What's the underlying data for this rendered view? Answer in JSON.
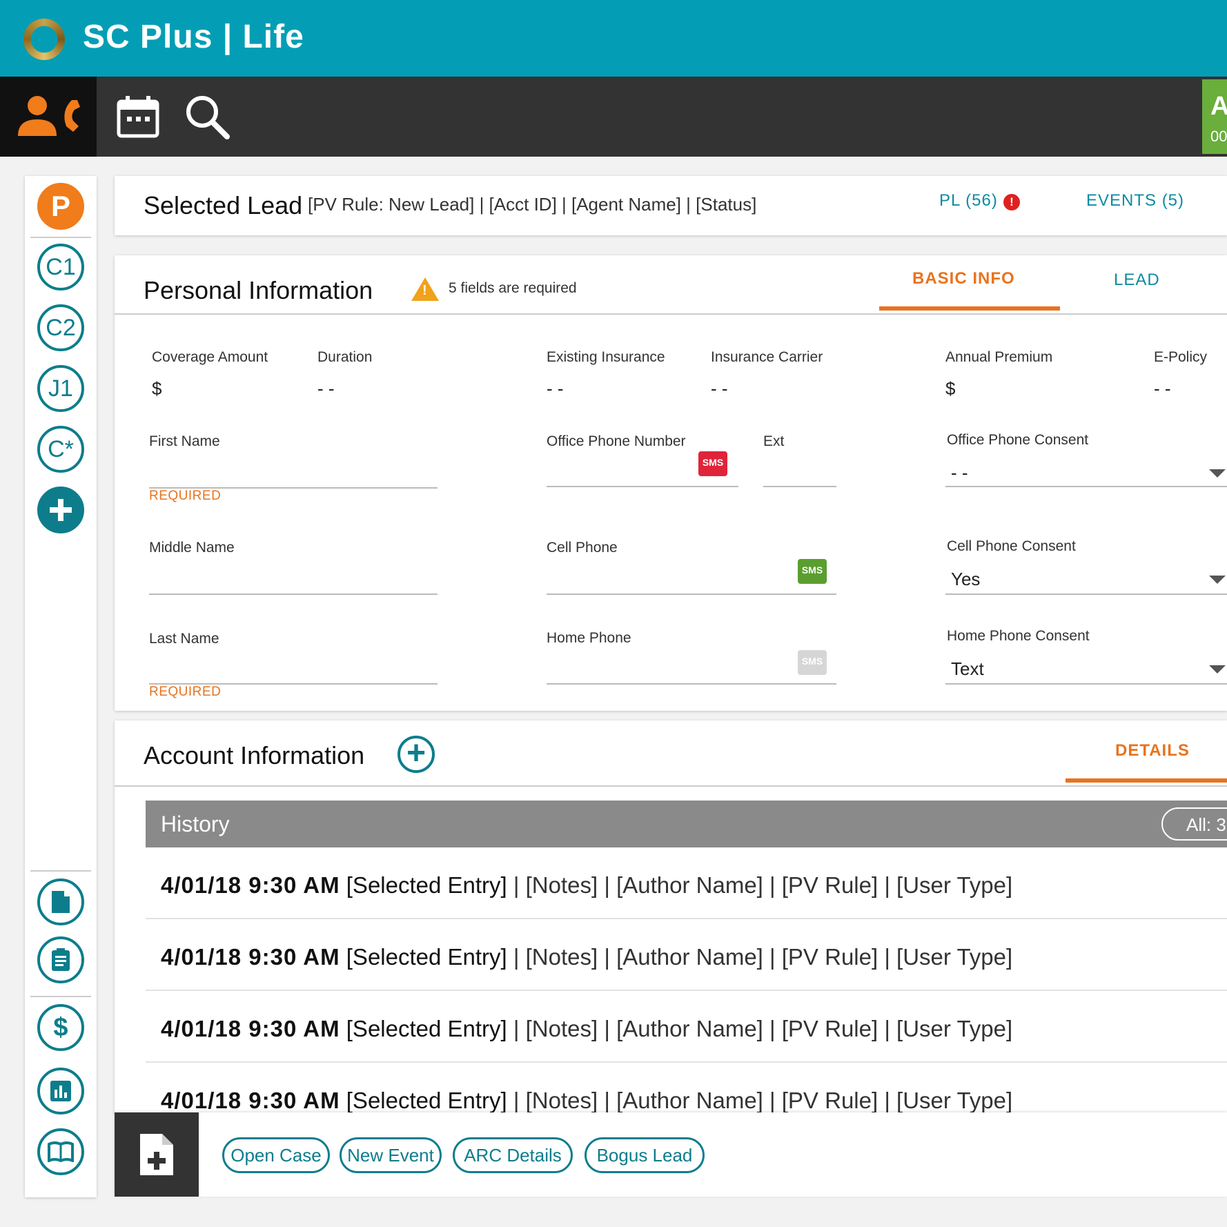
{
  "app": {
    "title": "SC Plus | Life"
  },
  "nav": {
    "green_badge_big": "A",
    "green_badge_small": "00"
  },
  "rail": {
    "items": [
      "P",
      "C1",
      "C2",
      "J1",
      "C*"
    ]
  },
  "lead": {
    "title": "Selected Lead",
    "meta": "[PV Rule: New Lead] | [Acct ID] | [Agent Name] | [Status]",
    "pl_link": "PL (56)",
    "pl_alert": "!",
    "events_link": "EVENTS (5)"
  },
  "personal": {
    "title": "Personal Information",
    "warning": "5 fields are required",
    "tabs": {
      "basic": "BASIC INFO",
      "lead": "LEAD"
    },
    "summary": [
      {
        "label": "Coverage Amount",
        "value": "$"
      },
      {
        "label": "Duration",
        "value": "- -"
      },
      {
        "label": "Existing Insurance",
        "value": "- -"
      },
      {
        "label": "Insurance Carrier",
        "value": "- -"
      },
      {
        "label": "Annual Premium",
        "value": "$"
      },
      {
        "label": "E-Policy",
        "value": "- -"
      }
    ],
    "first_name": {
      "label": "First Name",
      "required": "REQUIRED"
    },
    "middle_name": {
      "label": "Middle Name"
    },
    "last_name": {
      "label": "Last Name",
      "required": "REQUIRED"
    },
    "office_phone": {
      "label": "Office Phone Number",
      "sms": "SMS"
    },
    "ext": {
      "label": "Ext"
    },
    "cell_phone": {
      "label": "Cell Phone",
      "sms": "SMS"
    },
    "home_phone": {
      "label": "Home Phone",
      "sms": "SMS"
    },
    "office_consent": {
      "label": "Office Phone Consent",
      "value": "- -"
    },
    "cell_consent": {
      "label": "Cell Phone Consent",
      "value": "Yes"
    },
    "home_consent": {
      "label": "Home Phone Consent",
      "value": "Text"
    }
  },
  "account": {
    "title": "Account Information",
    "tab_details": "DETAILS",
    "history": {
      "title": "History",
      "all_label": "All: 3",
      "rows": [
        {
          "date": "4/01/18 9:30 AM",
          "entry": "[Selected Entry]",
          "rest": " | [Notes] | [Author Name] | [PV Rule] | [User Type]"
        },
        {
          "date": "4/01/18 9:30 AM",
          "entry": "[Selected Entry]",
          "rest": " | [Notes] | [Author Name] | [PV Rule] | [User Type]"
        },
        {
          "date": "4/01/18 9:30 AM",
          "entry": "[Selected Entry]",
          "rest": " | [Notes] | [Author Name] | [PV Rule] | [User Type]"
        },
        {
          "date": "4/01/18 9:30 AM",
          "entry": "[Selected Entry]",
          "rest": " | [Notes] | [Author Name] | [PV Rule] | [User Type]"
        }
      ]
    }
  },
  "actions": [
    "Open Case",
    "New Event",
    "ARC Details",
    "Bogus Lead"
  ],
  "colors": {
    "header": "#039eb5",
    "accent": "#e8731d",
    "teal": "#0d7d8c",
    "nav": "#333333",
    "green": "#6aae3c"
  }
}
